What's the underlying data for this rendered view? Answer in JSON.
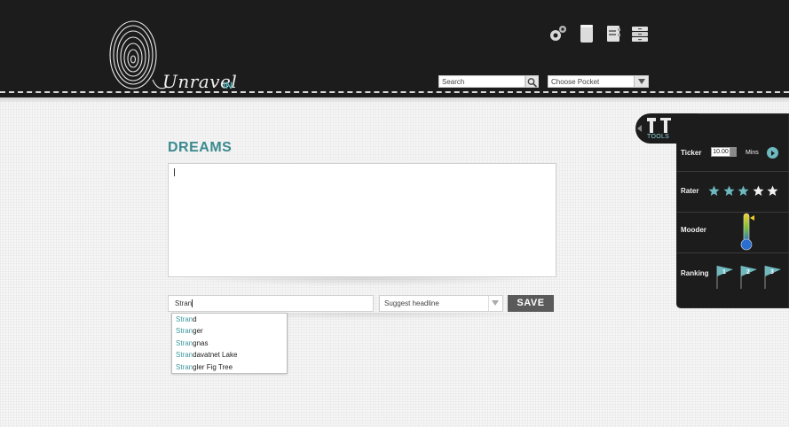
{
  "header": {
    "logo_text": "Unravel",
    "logo_suffix": "IN",
    "search_placeholder": "Search",
    "pocket_select": "Choose Pocket",
    "icons": [
      "gears-icon",
      "jar-icon",
      "address-book-icon",
      "archive-icon"
    ]
  },
  "main": {
    "title": "DREAMS",
    "body_text": "",
    "headline_value": "Stran",
    "suggest_select": "Suggest headline",
    "save_label": "SAVE",
    "autocomplete": [
      {
        "match": "Stran",
        "rest": "d"
      },
      {
        "match": "Stran",
        "rest": "ger"
      },
      {
        "match": "Stran",
        "rest": "gnas"
      },
      {
        "match": "Stran",
        "rest": "davatnet Lake"
      },
      {
        "match": "Stran",
        "rest": "gler Fig Tree"
      }
    ]
  },
  "tools": {
    "tab_label": "TOOLS",
    "ticker_label": "Ticker",
    "ticker_value": "10.00",
    "ticker_unit": "Mins",
    "rater_label": "Rater",
    "rater_total": 5,
    "rater_filled": 3,
    "mooder_label": "Mooder",
    "ranking_label": "Ranking",
    "ranking_flags": [
      "1",
      "2",
      "3"
    ]
  },
  "colors": {
    "header_bg": "#1c1c1c",
    "accent": "#3a8a90",
    "accent_light": "#6db9bf",
    "save_bg": "#5a5a5a"
  }
}
